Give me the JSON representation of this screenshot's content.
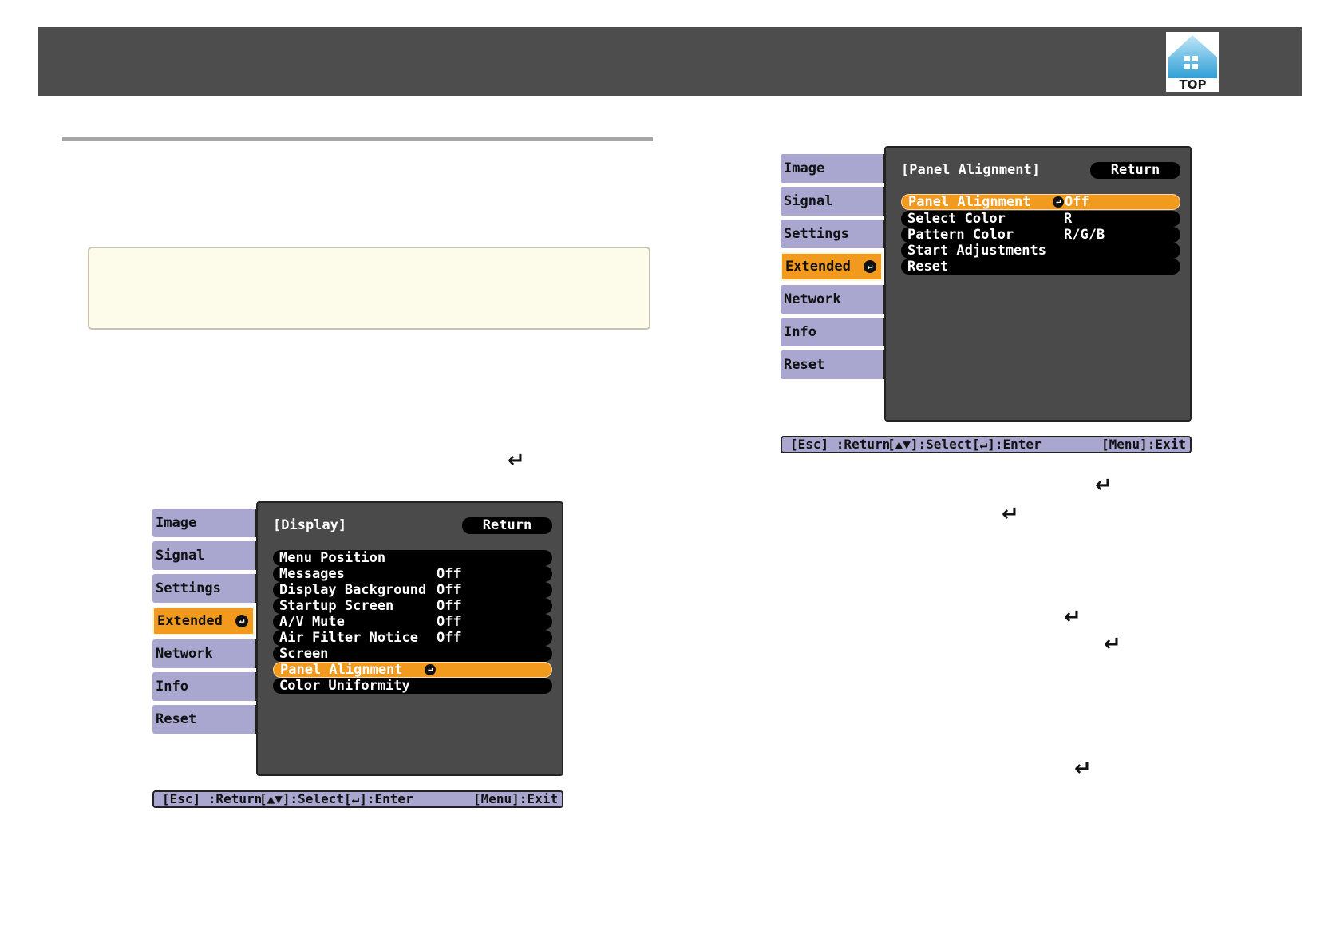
{
  "header": {
    "top_label": "TOP"
  },
  "menu_left": {
    "side_items": [
      "Image",
      "Signal",
      "Settings",
      "Extended",
      "Network",
      "Info",
      "Reset"
    ],
    "active_index": 3,
    "panel_title": "[Display]",
    "return_label": "Return",
    "rows": [
      {
        "label": "Menu Position",
        "value": ""
      },
      {
        "label": "Messages",
        "value": "Off"
      },
      {
        "label": "Display Background",
        "value": "Off"
      },
      {
        "label": "Startup Screen",
        "value": "Off"
      },
      {
        "label": "A/V Mute",
        "value": "Off"
      },
      {
        "label": "Air Filter Notice",
        "value": "Off"
      },
      {
        "label": "Screen",
        "value": ""
      },
      {
        "label": "Panel Alignment",
        "value": ""
      },
      {
        "label": "Color Uniformity",
        "value": ""
      }
    ],
    "highlight_row": 7,
    "footer": {
      "esc": "[Esc] :Return",
      "select": "[▲▼]:Select",
      "enter": "[↵]:Enter",
      "exit": "[Menu]:Exit"
    }
  },
  "menu_right": {
    "side_items": [
      "Image",
      "Signal",
      "Settings",
      "Extended",
      "Network",
      "Info",
      "Reset"
    ],
    "active_index": 3,
    "panel_title": "[Panel Alignment]",
    "return_label": "Return",
    "rows": [
      {
        "label": "Panel Alignment",
        "value": "Off"
      },
      {
        "label": "Select Color",
        "value": "R"
      },
      {
        "label": "Pattern Color",
        "value": "R/G/B"
      },
      {
        "label": "Start Adjustments",
        "value": ""
      },
      {
        "label": "Reset",
        "value": ""
      }
    ],
    "highlight_row": 0,
    "footer": {
      "esc": "[Esc] :Return",
      "select": "[▲▼]:Select",
      "enter": "[↵]:Enter",
      "exit": "[Menu]:Exit"
    }
  },
  "glyphs": {
    "enter": "↵"
  }
}
